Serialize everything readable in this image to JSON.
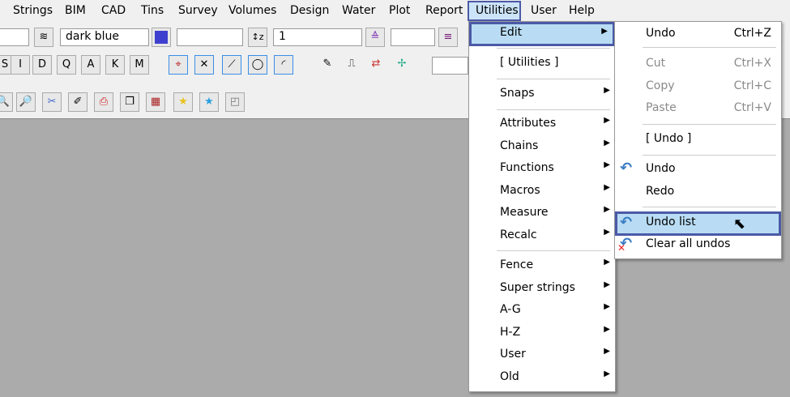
{
  "menubar": [
    "Strings",
    "BIM",
    "CAD",
    "Tins",
    "Survey",
    "Volumes",
    "Design",
    "Water",
    "Plot",
    "Report",
    "Utilities",
    "User",
    "Help"
  ],
  "toolbar": {
    "colour_value": "dark blue",
    "colour_swatch": "#3f3fcf",
    "level_value": "1",
    "mode_buttons": [
      "S",
      "I",
      "D",
      "Q",
      "A",
      "K",
      "M"
    ]
  },
  "utilities_menu": [
    {
      "label": "Edit",
      "arrow": "▶"
    },
    {
      "label": "[ Utilities ]"
    },
    {
      "label": "Snaps",
      "arrow": "▶"
    },
    {
      "label": "Attributes",
      "arrow": "▶"
    },
    {
      "label": "Chains",
      "arrow": "▶"
    },
    {
      "label": "Functions",
      "arrow": "▶"
    },
    {
      "label": "Macros",
      "arrow": "▶"
    },
    {
      "label": "Measure",
      "arrow": "▶"
    },
    {
      "label": "Recalc",
      "arrow": "▶"
    },
    {
      "label": "Fence",
      "arrow": "▶"
    },
    {
      "label": "Super strings",
      "arrow": "▶"
    },
    {
      "label": "A-G",
      "arrow": "▶"
    },
    {
      "label": "H-Z",
      "arrow": "▶"
    },
    {
      "label": "User",
      "arrow": "▶"
    },
    {
      "label": "Old",
      "arrow": "▶"
    }
  ],
  "edit_submenu": [
    {
      "label": "Undo",
      "shortcut": "Ctrl+Z"
    },
    {
      "label": "Cut",
      "shortcut": "Ctrl+X"
    },
    {
      "label": "Copy",
      "shortcut": "Ctrl+C"
    },
    {
      "label": "Paste",
      "shortcut": "Ctrl+V"
    },
    {
      "label": "[ Undo ]"
    },
    {
      "label": "Undo"
    },
    {
      "label": "Redo"
    },
    {
      "label": "Undo list"
    },
    {
      "label": "Clear all undos"
    }
  ],
  "accent": "#4b5aa7"
}
